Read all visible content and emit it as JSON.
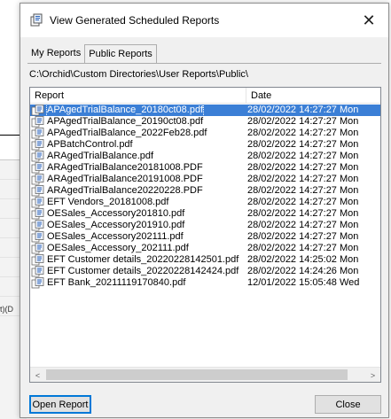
{
  "background": {
    "snippet": "t)(D"
  },
  "dialog": {
    "title": "View Generated Scheduled Reports",
    "close_glyph": "✕",
    "tabs": [
      {
        "label": "My Reports",
        "active": false
      },
      {
        "label": "Public Reports",
        "active": true
      }
    ],
    "path": "C:\\Orchid\\Custom Directories\\User Reports\\Public\\",
    "columns": {
      "report": "Report",
      "date": "Date"
    },
    "rows": [
      {
        "name": "APAgedTrialBalance_20180ct08.pdf",
        "date": "28/02/2022 14:27:27 Mon",
        "selected": true
      },
      {
        "name": "APAgedTrialBalance_20190ct08.pdf",
        "date": "28/02/2022 14:27:27 Mon"
      },
      {
        "name": "APAgedTrialBalance_2022Feb28.pdf",
        "date": "28/02/2022 14:27:27 Mon"
      },
      {
        "name": "APBatchControl.pdf",
        "date": "28/02/2022 14:27:27 Mon"
      },
      {
        "name": "ARAgedTrialBalance.pdf",
        "date": "28/02/2022 14:27:27 Mon"
      },
      {
        "name": "ARAgedTrialBalance20181008.PDF",
        "date": "28/02/2022 14:27:27 Mon"
      },
      {
        "name": "ARAgedTrialBalance20191008.PDF",
        "date": "28/02/2022 14:27:27 Mon"
      },
      {
        "name": "ARAgedTrialBalance20220228.PDF",
        "date": "28/02/2022 14:27:27 Mon"
      },
      {
        "name": "EFT Vendors_20181008.pdf",
        "date": "28/02/2022 14:27:27 Mon"
      },
      {
        "name": "OESales_Accessory201810.pdf",
        "date": "28/02/2022 14:27:27 Mon"
      },
      {
        "name": "OESales_Accessory201910.pdf",
        "date": "28/02/2022 14:27:27 Mon"
      },
      {
        "name": "OESales_Accessory202111.pdf",
        "date": "28/02/2022 14:27:27 Mon"
      },
      {
        "name": "OESales_Accessory_202111.pdf",
        "date": "28/02/2022 14:27:27 Mon"
      },
      {
        "name": "EFT Customer details_20220228142501.pdf",
        "date": "28/02/2022 14:25:02 Mon"
      },
      {
        "name": "EFT Customer details_20220228142424.pdf",
        "date": "28/02/2022 14:24:26 Mon"
      },
      {
        "name": "EFT Bank_20211119170840.pdf",
        "date": "12/01/2022 15:05:48 Wed"
      }
    ],
    "scroll": {
      "left_glyph": "<",
      "right_glyph": ">"
    },
    "buttons": {
      "open": "Open Report",
      "close": "Close"
    },
    "colors": {
      "selection": "#3b7fd6",
      "focus_border": "#0078d7"
    }
  }
}
